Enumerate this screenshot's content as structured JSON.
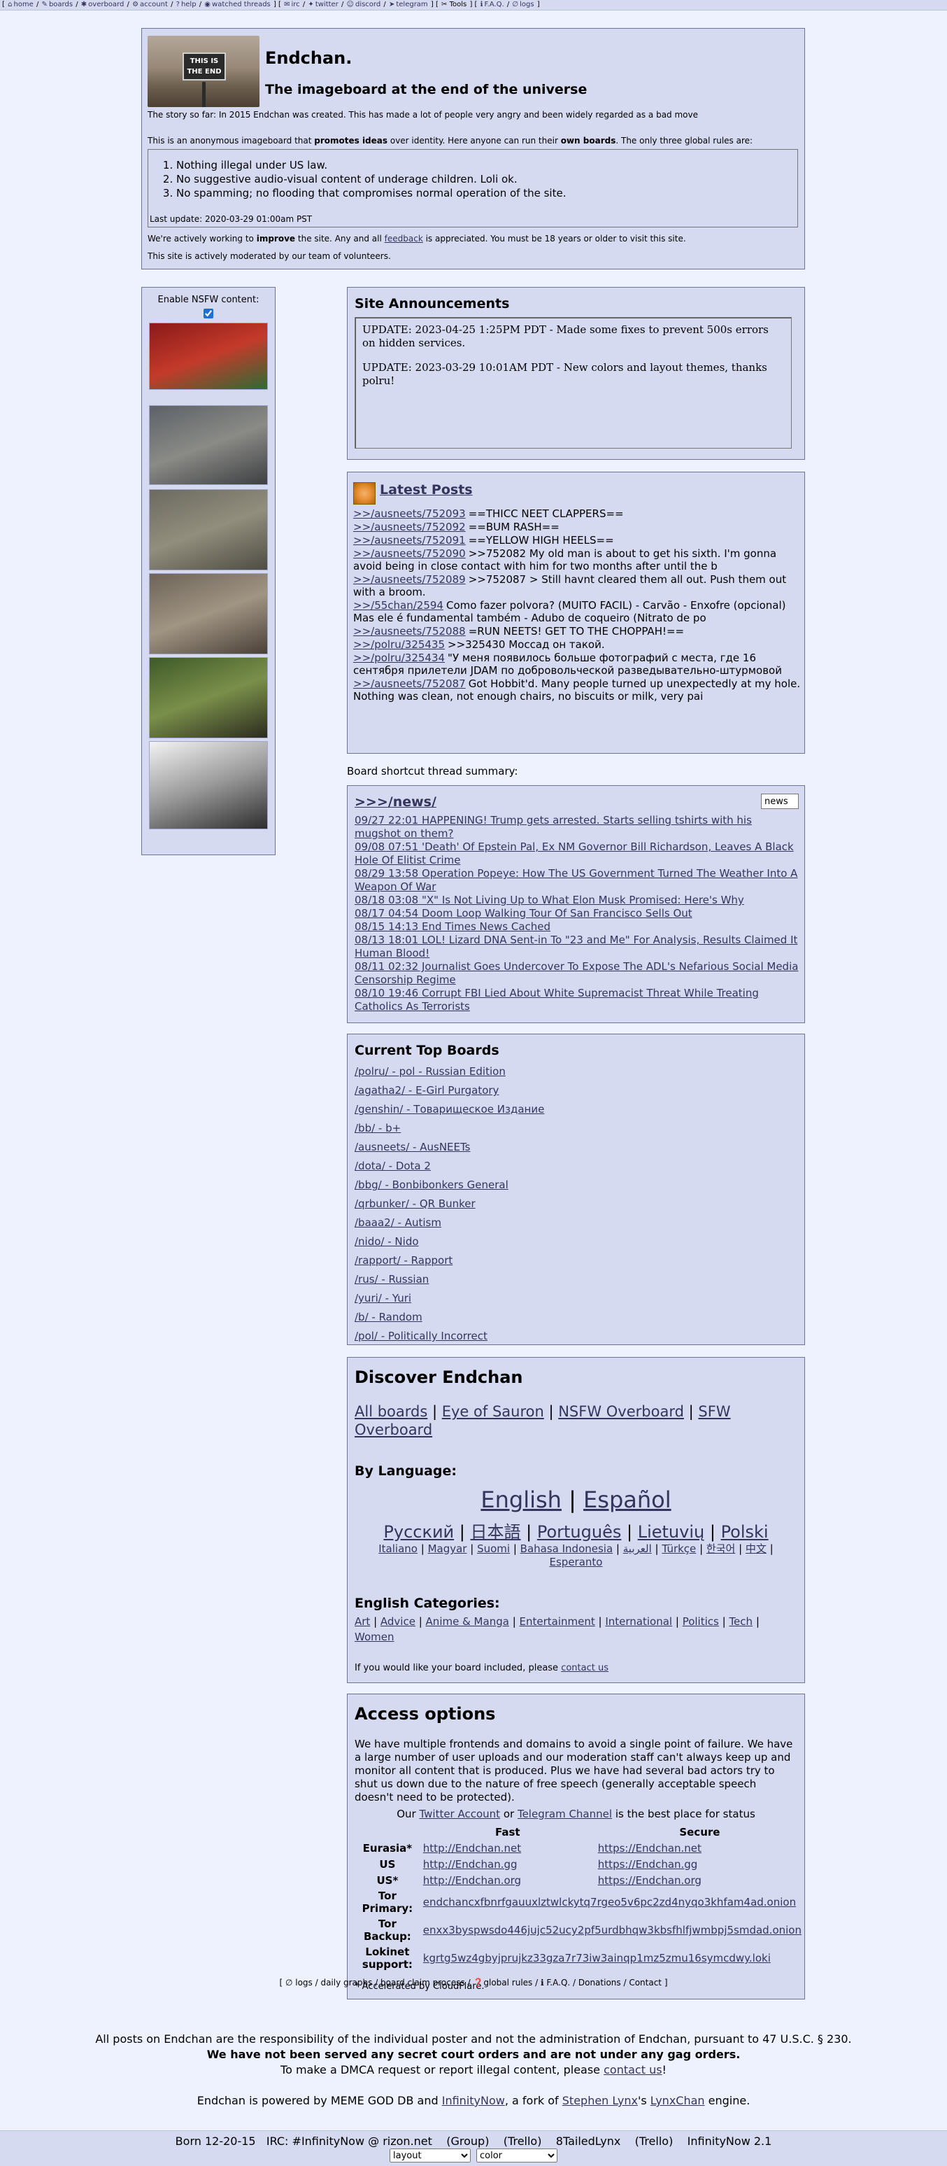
{
  "topbar": {
    "open": "[",
    "items": [
      {
        "icon": "⌂",
        "label": "home"
      },
      {
        "icon": "✎",
        "label": "boards"
      },
      {
        "icon": "✱",
        "label": "overboard"
      },
      {
        "icon": "⚙",
        "label": "account"
      },
      {
        "icon": "?",
        "label": "help"
      },
      {
        "icon": "◉",
        "label": "watched threads"
      }
    ],
    "mid": "] [",
    "items2": [
      {
        "icon": "✉",
        "label": "irc"
      },
      {
        "icon": "✦",
        "label": "twitter"
      },
      {
        "icon": "☺",
        "label": "discord"
      },
      {
        "icon": "➤",
        "label": "telegram"
      }
    ],
    "mid2": "] [",
    "tools": {
      "icon": "✂",
      "label": "Tools"
    },
    "mid3": "] [",
    "items3": [
      {
        "icon": "ℹ",
        "label": "F.A.Q."
      },
      {
        "icon": "∅",
        "label": "logs"
      }
    ],
    "close": "]"
  },
  "header": {
    "logo_text_line1": "THIS IS",
    "logo_text_line2": "THE END",
    "title": "Endchan.",
    "subtitle": "The imageboard at the end of the universe",
    "story": "The story so far: In 2015 Endchan was created. This has made a lot of people very angry and been widely regarded as a bad move",
    "intro_a": "This is an anonymous imageboard that ",
    "intro_b": "promotes ideas",
    "intro_c": " over identity. Here anyone can run their ",
    "intro_d": "own boards",
    "intro_e": ". The only three global rules are:",
    "rules": [
      "Nothing illegal under US law.",
      "No suggestive audio-visual content of underage children. Loli ok.",
      "No spamming; no flooding that compromises normal operation of the site."
    ],
    "last_update": "Last update: 2020-03-29 01:00am PST",
    "working_a": "We're actively working to ",
    "working_b": "improve",
    "working_c": " the site. Any and all ",
    "working_link": "feedback",
    "working_d": " is appreciated. You must be 18 years or older to visit this site.",
    "moderated": "This site is actively moderated by our team of volunteers."
  },
  "nsfw": {
    "label": "Enable NSFW content:",
    "checked": true,
    "thumbs": [
      {
        "name": "tea-box-thumbnail",
        "colors": [
          "#8a1a1a",
          "#c43a2a",
          "#2e6b35"
        ]
      },
      {
        "name": "rubble-thumbnail",
        "colors": [
          "#5d6168",
          "#8a8b86",
          "#3d3f42"
        ]
      },
      {
        "name": "debris-field-thumbnail",
        "colors": [
          "#6c6a60",
          "#918e7d",
          "#4f4c43"
        ]
      },
      {
        "name": "destroyed-building-thumbnail",
        "colors": [
          "#6d6357",
          "#a09583",
          "#4a4038"
        ]
      },
      {
        "name": "soldier-thumbnail",
        "colors": [
          "#3f5a29",
          "#7a8f4a",
          "#2b2b1f"
        ]
      },
      {
        "name": "coal-shovel-thumbnail",
        "colors": [
          "#f3f3f3",
          "#9a9a9a",
          "#2d2d2d"
        ]
      }
    ]
  },
  "announcements": {
    "title": "Site Announcements",
    "items": [
      "UPDATE: 2023-04-25 1:25PM PDT - Made some fixes to prevent 500s errors on hidden services.",
      "UPDATE: 2023-03-29 10:01AM PDT - New colors and layout themes, thanks polru!"
    ]
  },
  "latest_posts": {
    "title": "Latest Posts",
    "items": [
      {
        "link": ">>/ausneets/752093",
        "text": "==THICC NEET CLAPPERS=="
      },
      {
        "link": ">>/ausneets/752092",
        "text": "==BUM RASH=="
      },
      {
        "link": ">>/ausneets/752091",
        "text": "==YELLOW HIGH HEELS=="
      },
      {
        "link": ">>/ausneets/752090",
        "text": ">>752082 My old man is about to get his sixth. I'm gonna avoid being in close contact with him for two months after until the b"
      },
      {
        "link": ">>/ausneets/752089",
        "text": ">>752087 > Still havnt cleared them all out. Push them out with a broom."
      },
      {
        "link": ">>/55chan/2594",
        "text": "Como fazer polvora? (MUITO FACIL) - Carvão - Enxofre (opcional) Mas ele é fundamental também - Adubo de coqueiro (Nitrato de po"
      },
      {
        "link": ">>/ausneets/752088",
        "text": "=RUN NEETS! GET TO THE CHOPPAH!=="
      },
      {
        "link": ">>/polru/325435",
        "text": ">>325430 Моссад он такой."
      },
      {
        "link": ">>/polru/325434",
        "text": "\"У меня появилось больше фотографий с места, где 16 сентября прилетели JDAM по добровольческой разведывательно-штурмовой бригаде"
      },
      {
        "link": ">>/ausneets/752087",
        "text": "Got Hobbit'd. Many people turned up unexpectedly at my hole. Nothing was clean, not enough chairs, no biscuits or milk, very pai"
      }
    ]
  },
  "shortcut_label": "Board shortcut thread summary:",
  "news": {
    "title": ">>>/news/",
    "search_value": "news",
    "items": [
      "09/27 22:01 HAPPENING! Trump gets arrested. Starts selling tshirts with his mugshot on them?",
      "09/08 07:51 'Death' Of Epstein Pal, Ex NM Governor Bill Richardson, Leaves A Black Hole Of Elitist Crime",
      "08/29 13:58 Operation Popeye: How The US Government Turned The Weather Into A Weapon Of War",
      "08/18 03:08 \"X\" Is Not Living Up to What Elon Musk Promised: Here's Why",
      "08/17 04:54 Doom Loop Walking Tour Of San Francisco Sells Out",
      "08/15 14:13 End Times News Cached",
      "08/13 18:01 LOL! Lizard DNA Sent-in To \"23 and Me\" For Analysis, Results Claimed It Human Blood!",
      "08/11 02:32 Journalist Goes Undercover To Expose The ADL's Nefarious Social Media Censorship Regime",
      "08/10 19:46 Corrupt FBI Lied About White Supremacist Threat While Treating Catholics As Terrorists"
    ]
  },
  "top_boards": {
    "title": "Current Top Boards",
    "items": [
      "/polru/ - pol - Russian Edition",
      "/agatha2/ - E-Girl Purgatory",
      "/genshin/ - Товарищеское Издание",
      "/bb/ - b+",
      "/ausneets/ - AusNEETs",
      "/dota/ - Dota 2",
      "/bbg/ - Bonbibonkers General",
      "/qrbunker/ - QR Bunker",
      "/baaa2/ - Autism",
      "/nido/ - Nido",
      "/rapport/ - Rapport",
      "/rus/ - Russian",
      "/yuri/ - Yuri",
      "/b/ - Random",
      "/pol/ - Politically Incorrect"
    ]
  },
  "discover": {
    "title": "Discover Endchan",
    "links": [
      "All boards",
      "Eye of Sauron",
      "NSFW Overboard",
      "SFW Overboard"
    ],
    "sep": " | ",
    "by_language_title": "By Language:",
    "lang_big": [
      "English",
      "Español"
    ],
    "lang_mid": [
      "Русский",
      "日本語",
      "Português",
      "Lietuvių",
      "Polski"
    ],
    "lang_small": [
      "Italiano",
      "Magyar",
      "Suomi",
      "Bahasa Indonesia",
      "العربية",
      "Türkçe",
      "한국어",
      "中文",
      "Esperanto"
    ],
    "eng_cat_title": "English Categories:",
    "eng_cats": [
      "Art",
      "Advice",
      "Anime & Manga",
      "Entertainment",
      "International",
      "Politics",
      "Tech",
      "Women"
    ],
    "include_a": "If you would like your board included, please ",
    "include_link": "contact us"
  },
  "access": {
    "title": "Access options",
    "text": "We have multiple frontends and domains to avoid a single point of failure. We have a large number of user uploads and our moderation staff can't always keep up and monitor all content that is produced. Plus we have had several bad actors try to shut us down due to the nature of free speech (generally acceptable speech doesn't need to be protected).",
    "status_a": "Our ",
    "status_link1": "Twitter Account",
    "status_b": " or ",
    "status_link2": "Telegram Channel",
    "status_c": " is the best place for status",
    "col_fast": "Fast",
    "col_secure": "Secure",
    "rows": [
      {
        "label": "Eurasia*",
        "fast": "http://Endchan.net",
        "secure": "https://Endchan.net"
      },
      {
        "label": "US",
        "fast": "http://Endchan.gg",
        "secure": "https://Endchan.gg"
      },
      {
        "label": "US*",
        "fast": "http://Endchan.org",
        "secure": "https://Endchan.org"
      }
    ],
    "tor_rows": [
      {
        "label": "Tor Primary:",
        "addr": "endchancxfbnrfgauuxlztwlckytq7rgeo5v6pc2zd4nyqo3khfam4ad.onion"
      },
      {
        "label": "Tor Backup:",
        "addr": "enxx3byspwsdo446jujc52ucy2pf5urdbhqw3kbsfhlfjwmbpj5smdad.onion"
      },
      {
        "label": "Lokinet support:",
        "addr": "kgrtg5wz4gbyjprujkz33gza7r73iw3ainqp1mz5zmu16symcdwy.loki"
      }
    ],
    "accel": "* Accelerated by CloudFlare."
  },
  "footer": {
    "links_line": "[ ∅ logs / daily graphs / board claim process / ❓global rules / ℹ F.A.Q. / Donations / Contact ]",
    "legal1": "All posts on Endchan are the responsibility of the individual poster and not the administration of Endchan, pursuant to 47 U.S.C. § 230.",
    "legal2": "We have not been served any secret court orders and are not under any gag orders.",
    "legal3_a": "To make a DMCA request or report illegal content, please ",
    "legal3_link": "contact us",
    "legal3_b": "!",
    "powered_a": "Endchan is powered by MEME GOD DB and ",
    "powered_link1": "InfinityNow",
    "powered_b": ", a fork of ",
    "powered_link2": "Stephen Lynx",
    "powered_c": "'s ",
    "powered_link3": "LynxChan",
    "powered_d": " engine.",
    "bottom_line": "Born 12-20-15   IRC: #InfinityNow @ rizon.net    (Group)    (Trello)    8TailedLynx    (Trello)    InfinityNow 2.1",
    "layout_select": "layout",
    "color_select": "color"
  }
}
